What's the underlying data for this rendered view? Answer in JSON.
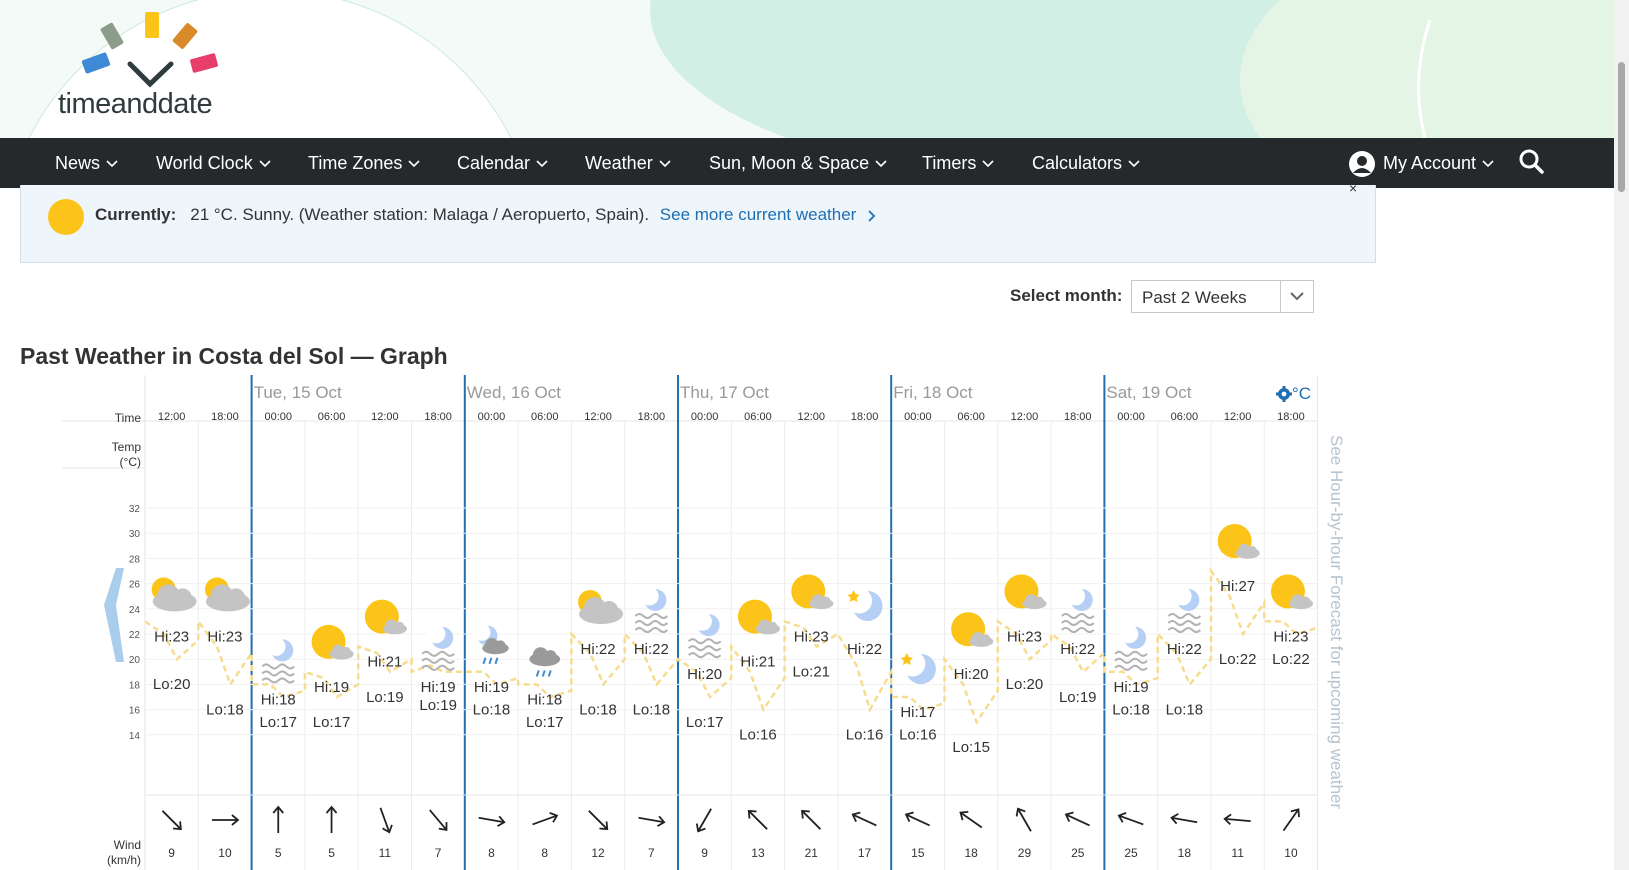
{
  "logo": {
    "text_a": "timeand",
    "text_b": "date"
  },
  "nav": {
    "items": [
      "News",
      "World Clock",
      "Time Zones",
      "Calendar",
      "Weather",
      "Sun, Moon & Space",
      "Timers",
      "Calculators"
    ],
    "account": "My Account"
  },
  "current": {
    "label": "Currently:",
    "text": "21 °C. Sunny. (Weather station: Malaga / Aeropuerto, Spain).",
    "link": "See more current weather",
    "close": "×"
  },
  "select_month": {
    "label": "Select month:",
    "value": "Past 2 Weeks"
  },
  "title": "Past Weather in Costa del Sol — Graph",
  "graph": {
    "unit": "°C",
    "row_labels": {
      "time": "Time",
      "temp": "Temp",
      "temp_unit": "(°C)",
      "wind": "Wind",
      "wind_unit": "(km/h)"
    },
    "side_text": "See Hour-by-hour Forecast for upcoming weather",
    "days": [
      "Tue, 15 Oct",
      "Wed, 16 Oct",
      "Thu, 17 Oct",
      "Fri, 18 Oct",
      "Sat, 19 Oct"
    ],
    "y_ticks": [
      32,
      30,
      28,
      26,
      24,
      22,
      20,
      18,
      16,
      14
    ],
    "colors": {
      "sun": "#fcc419",
      "moon": "#b5cff5",
      "cloud": "#c4c4c4",
      "day_line": "#1f6fb2",
      "temp_line": "#f7dc8e"
    },
    "columns": [
      {
        "time": "12:00",
        "hi": "Hi:23",
        "lo": "Lo:20",
        "icon": "partly-cloudy-day",
        "wind": "9",
        "wdir": 315
      },
      {
        "time": "18:00",
        "hi": "Hi:23",
        "lo": "Lo:18",
        "icon": "partly-cloudy-day",
        "wind": "10",
        "wdir": 270
      },
      {
        "time": "00:00",
        "hi": "Hi:18",
        "lo": "Lo:17",
        "icon": "fog-night",
        "wind": "5",
        "wdir": 180
      },
      {
        "time": "06:00",
        "hi": "Hi:19",
        "lo": "Lo:17",
        "icon": "sun-cloud",
        "wind": "5",
        "wdir": 180
      },
      {
        "time": "12:00",
        "hi": "Hi:21",
        "lo": "Lo:19",
        "icon": "sun-cloud",
        "wind": "11",
        "wdir": 340
      },
      {
        "time": "18:00",
        "hi": "Hi:19",
        "lo": "Lo:19",
        "icon": "fog-night",
        "wind": "7",
        "wdir": 320
      },
      {
        "time": "00:00",
        "hi": "Hi:19",
        "lo": "Lo:18",
        "icon": "rain-night",
        "wind": "8",
        "wdir": 280
      },
      {
        "time": "06:00",
        "hi": "Hi:18",
        "lo": "Lo:17",
        "icon": "rain",
        "wind": "8",
        "wdir": 250
      },
      {
        "time": "12:00",
        "hi": "Hi:22",
        "lo": "Lo:18",
        "icon": "partly-cloudy-day",
        "wind": "12",
        "wdir": 315
      },
      {
        "time": "18:00",
        "hi": "Hi:22",
        "lo": "Lo:18",
        "icon": "fog-night",
        "wind": "7",
        "wdir": 280
      },
      {
        "time": "00:00",
        "hi": "Hi:20",
        "lo": "Lo:17",
        "icon": "fog-night",
        "wind": "9",
        "wdir": 30
      },
      {
        "time": "06:00",
        "hi": "Hi:21",
        "lo": "Lo:16",
        "icon": "sun-cloud",
        "wind": "13",
        "wdir": 135
      },
      {
        "time": "12:00",
        "hi": "Hi:23",
        "lo": "Lo:21",
        "icon": "sun-cloud",
        "wind": "21",
        "wdir": 135
      },
      {
        "time": "18:00",
        "hi": "Hi:22",
        "lo": "Lo:16",
        "icon": "moon-star",
        "wind": "17",
        "wdir": 115
      },
      {
        "time": "00:00",
        "hi": "Hi:17",
        "lo": "Lo:16",
        "icon": "moon-star",
        "wind": "15",
        "wdir": 115
      },
      {
        "time": "06:00",
        "hi": "Hi:20",
        "lo": "Lo:15",
        "icon": "sun-cloud",
        "wind": "18",
        "wdir": 125
      },
      {
        "time": "12:00",
        "hi": "Hi:23",
        "lo": "Lo:20",
        "icon": "sun-cloud",
        "wind": "29",
        "wdir": 150
      },
      {
        "time": "18:00",
        "hi": "Hi:22",
        "lo": "Lo:19",
        "icon": "fog-night",
        "wind": "25",
        "wdir": 115
      },
      {
        "time": "00:00",
        "hi": "Hi:19",
        "lo": "Lo:18",
        "icon": "fog-night",
        "wind": "25",
        "wdir": 110
      },
      {
        "time": "06:00",
        "hi": "Hi:22",
        "lo": "Lo:18",
        "icon": "fog-night",
        "wind": "18",
        "wdir": 100
      },
      {
        "time": "12:00",
        "hi": "Hi:27",
        "lo": "Lo:22",
        "icon": "sun-cloud",
        "wind": "11",
        "wdir": 95
      },
      {
        "time": "18:00",
        "hi": "Hi:23",
        "lo": "Lo:22",
        "icon": "sun-cloud",
        "wind": "10",
        "wdir": 215
      }
    ]
  }
}
